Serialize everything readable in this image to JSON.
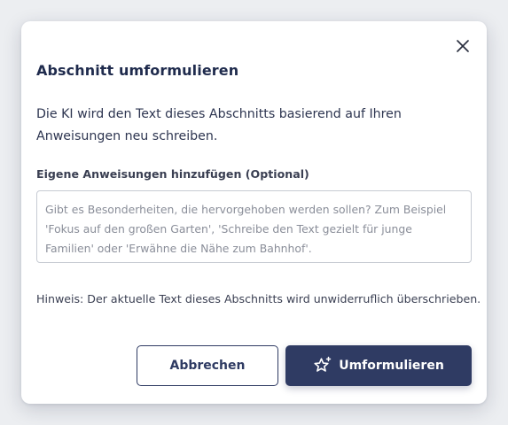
{
  "dialog": {
    "title": "Abschnitt umformulieren",
    "description": "Die KI wird den Text dieses Abschnitts basierend auf Ihren Anweisungen neu schreiben.",
    "instructions": {
      "label": "Eigene Anweisungen hinzufügen (Optional)",
      "value": "",
      "placeholder": "Gibt es Besonderheiten, die hervorgehoben werden sollen? Zum Beispiel 'Fokus auf den großen Garten', 'Schreibe den Text gezielt für junge Familien' oder 'Erwähne die Nähe zum Bahnhof'."
    },
    "hint": "Hinweis: Der aktuelle Text dieses Abschnitts wird unwiderruflich überschrieben.",
    "buttons": {
      "cancel_label": "Abbrechen",
      "submit_label": "Umformulieren",
      "submit_icon": "sparkle-star-icon"
    },
    "close_icon": "close-icon"
  },
  "colors": {
    "primary": "#2f3b63",
    "title": "#1f2b4d",
    "text": "#2d3550",
    "border": "#c7cbd3",
    "placeholder": "#8a8e99",
    "backdrop": "#eceef1"
  }
}
